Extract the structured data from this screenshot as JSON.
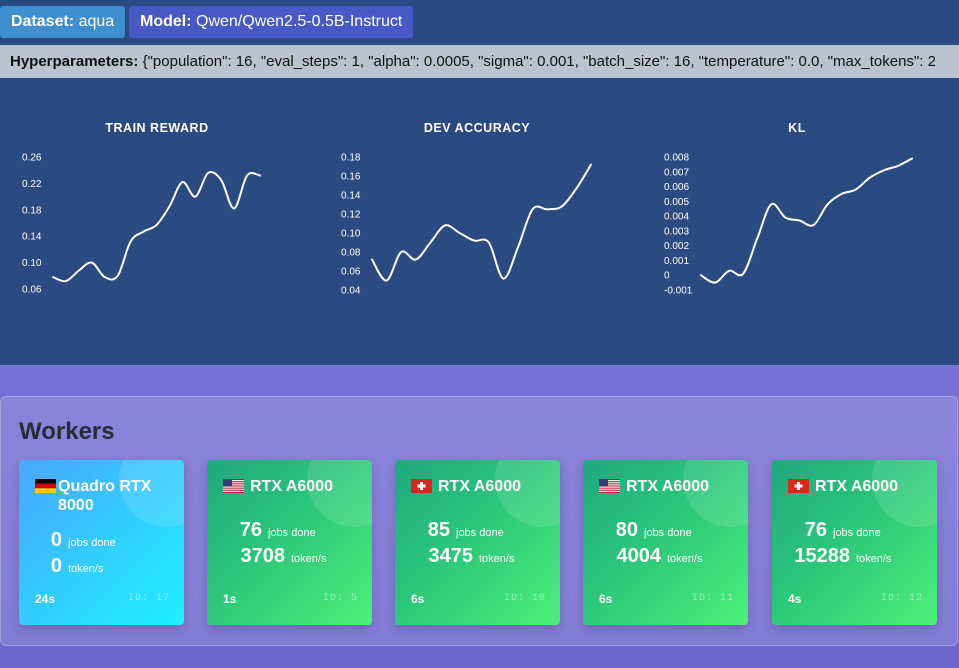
{
  "header": {
    "dataset_label": "Dataset:",
    "dataset_value": "aqua",
    "model_label": "Model:",
    "model_value": "Qwen/Qwen2.5-0.5B-Instruct",
    "hyper_label": "Hyperparameters:",
    "hyper_value": "{\"population\": 16, \"eval_steps\": 1, \"alpha\": 0.0005, \"sigma\": 0.001, \"batch_size\": 16, \"temperature\": 0.0, \"max_tokens\": 2"
  },
  "chart_data": [
    {
      "type": "line",
      "title": "TRAIN REWARD",
      "yticks": [
        "0.06",
        "0.10",
        "0.14",
        "0.18",
        "0.22",
        "0.26"
      ],
      "ylim": [
        0.06,
        0.26
      ],
      "color": "#ffffff",
      "x": [
        0,
        1,
        2,
        3,
        4,
        5,
        6,
        7,
        8,
        9,
        10,
        11,
        12,
        13,
        14,
        15,
        16
      ],
      "values": [
        0.078,
        0.072,
        0.088,
        0.1,
        0.078,
        0.08,
        0.132,
        0.147,
        0.157,
        0.185,
        0.222,
        0.2,
        0.236,
        0.225,
        0.182,
        0.232,
        0.232
      ]
    },
    {
      "type": "line",
      "title": "DEV ACCURACY",
      "yticks": [
        "0.04",
        "0.06",
        "0.08",
        "0.10",
        "0.12",
        "0.14",
        "0.16",
        "0.18"
      ],
      "ylim": [
        0.04,
        0.18
      ],
      "color": "#ffffff",
      "x": [
        0,
        1,
        2,
        3,
        4,
        5,
        6,
        7,
        8,
        9,
        10,
        11,
        12,
        13,
        14,
        15
      ],
      "values": [
        0.072,
        0.05,
        0.08,
        0.072,
        0.09,
        0.108,
        0.1,
        0.092,
        0.09,
        0.052,
        0.085,
        0.125,
        0.125,
        0.128,
        0.147,
        0.172
      ]
    },
    {
      "type": "line",
      "title": "KL",
      "yticks": [
        "-0.001",
        "0",
        "0.001",
        "0.002",
        "0.003",
        "0.004",
        "0.005",
        "0.006",
        "0.007",
        "0.008"
      ],
      "ylim": [
        -0.001,
        0.008
      ],
      "color": "#ffffff",
      "x": [
        0,
        1,
        2,
        3,
        4,
        5,
        6,
        7,
        8,
        9,
        10,
        11,
        12,
        13,
        14,
        15
      ],
      "values": [
        0.0,
        -0.0005,
        0.0003,
        0.0001,
        0.0025,
        0.0048,
        0.0039,
        0.0037,
        0.0034,
        0.0048,
        0.0055,
        0.0058,
        0.0066,
        0.0071,
        0.0074,
        0.0079
      ]
    }
  ],
  "workers": {
    "title": "Workers",
    "jobs_label": "jobs done",
    "tokens_label": "token/s",
    "items": [
      {
        "flag": "germany-flag",
        "gpu": "Quadro RTX 8000",
        "jobs": "0",
        "tokens": "0",
        "time": "24s",
        "id": "ID: 17",
        "theme": "cyan"
      },
      {
        "flag": "usa-flag",
        "gpu": "RTX A6000",
        "jobs": "76",
        "tokens": "3708",
        "time": "1s",
        "id": "ID: 5",
        "theme": "green"
      },
      {
        "flag": "switzerland-flag",
        "gpu": "RTX A6000",
        "jobs": "85",
        "tokens": "3475",
        "time": "6s",
        "id": "ID: 10",
        "theme": "green"
      },
      {
        "flag": "usa-flag",
        "gpu": "RTX A6000",
        "jobs": "80",
        "tokens": "4004",
        "time": "6s",
        "id": "ID: 11",
        "theme": "green"
      },
      {
        "flag": "switzerland-flag",
        "gpu": "RTX A6000",
        "jobs": "76",
        "tokens": "15288",
        "time": "4s",
        "id": "ID: 12",
        "theme": "green"
      }
    ]
  }
}
